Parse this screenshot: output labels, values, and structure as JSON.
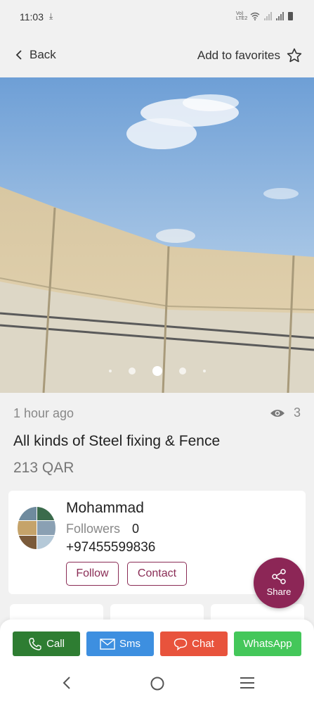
{
  "status_bar": {
    "time": "11:03",
    "network": "Vo) LTE2"
  },
  "nav": {
    "back_label": "Back",
    "favorites_label": "Add to favorites"
  },
  "gallery": {
    "slide_count": 5,
    "active_index": 2
  },
  "listing": {
    "posted": "1 hour ago",
    "views": "3",
    "title": "All kinds of Steel fixing & Fence",
    "price": "213 QAR"
  },
  "seller": {
    "name": "Mohammad",
    "followers_label": "Followers",
    "followers_count": "0",
    "phone": "+97455599836",
    "follow_label": "Follow",
    "contact_label": "Contact"
  },
  "share": {
    "label": "Share"
  },
  "actions": {
    "call": "Call",
    "sms": "Sms",
    "chat": "Chat",
    "whatsapp": "WhatsApp"
  },
  "colors": {
    "brand": "#8c2656",
    "call": "#2e7d32",
    "sms": "#3d8fe0",
    "chat": "#e8533c",
    "whatsapp": "#44c75a"
  }
}
